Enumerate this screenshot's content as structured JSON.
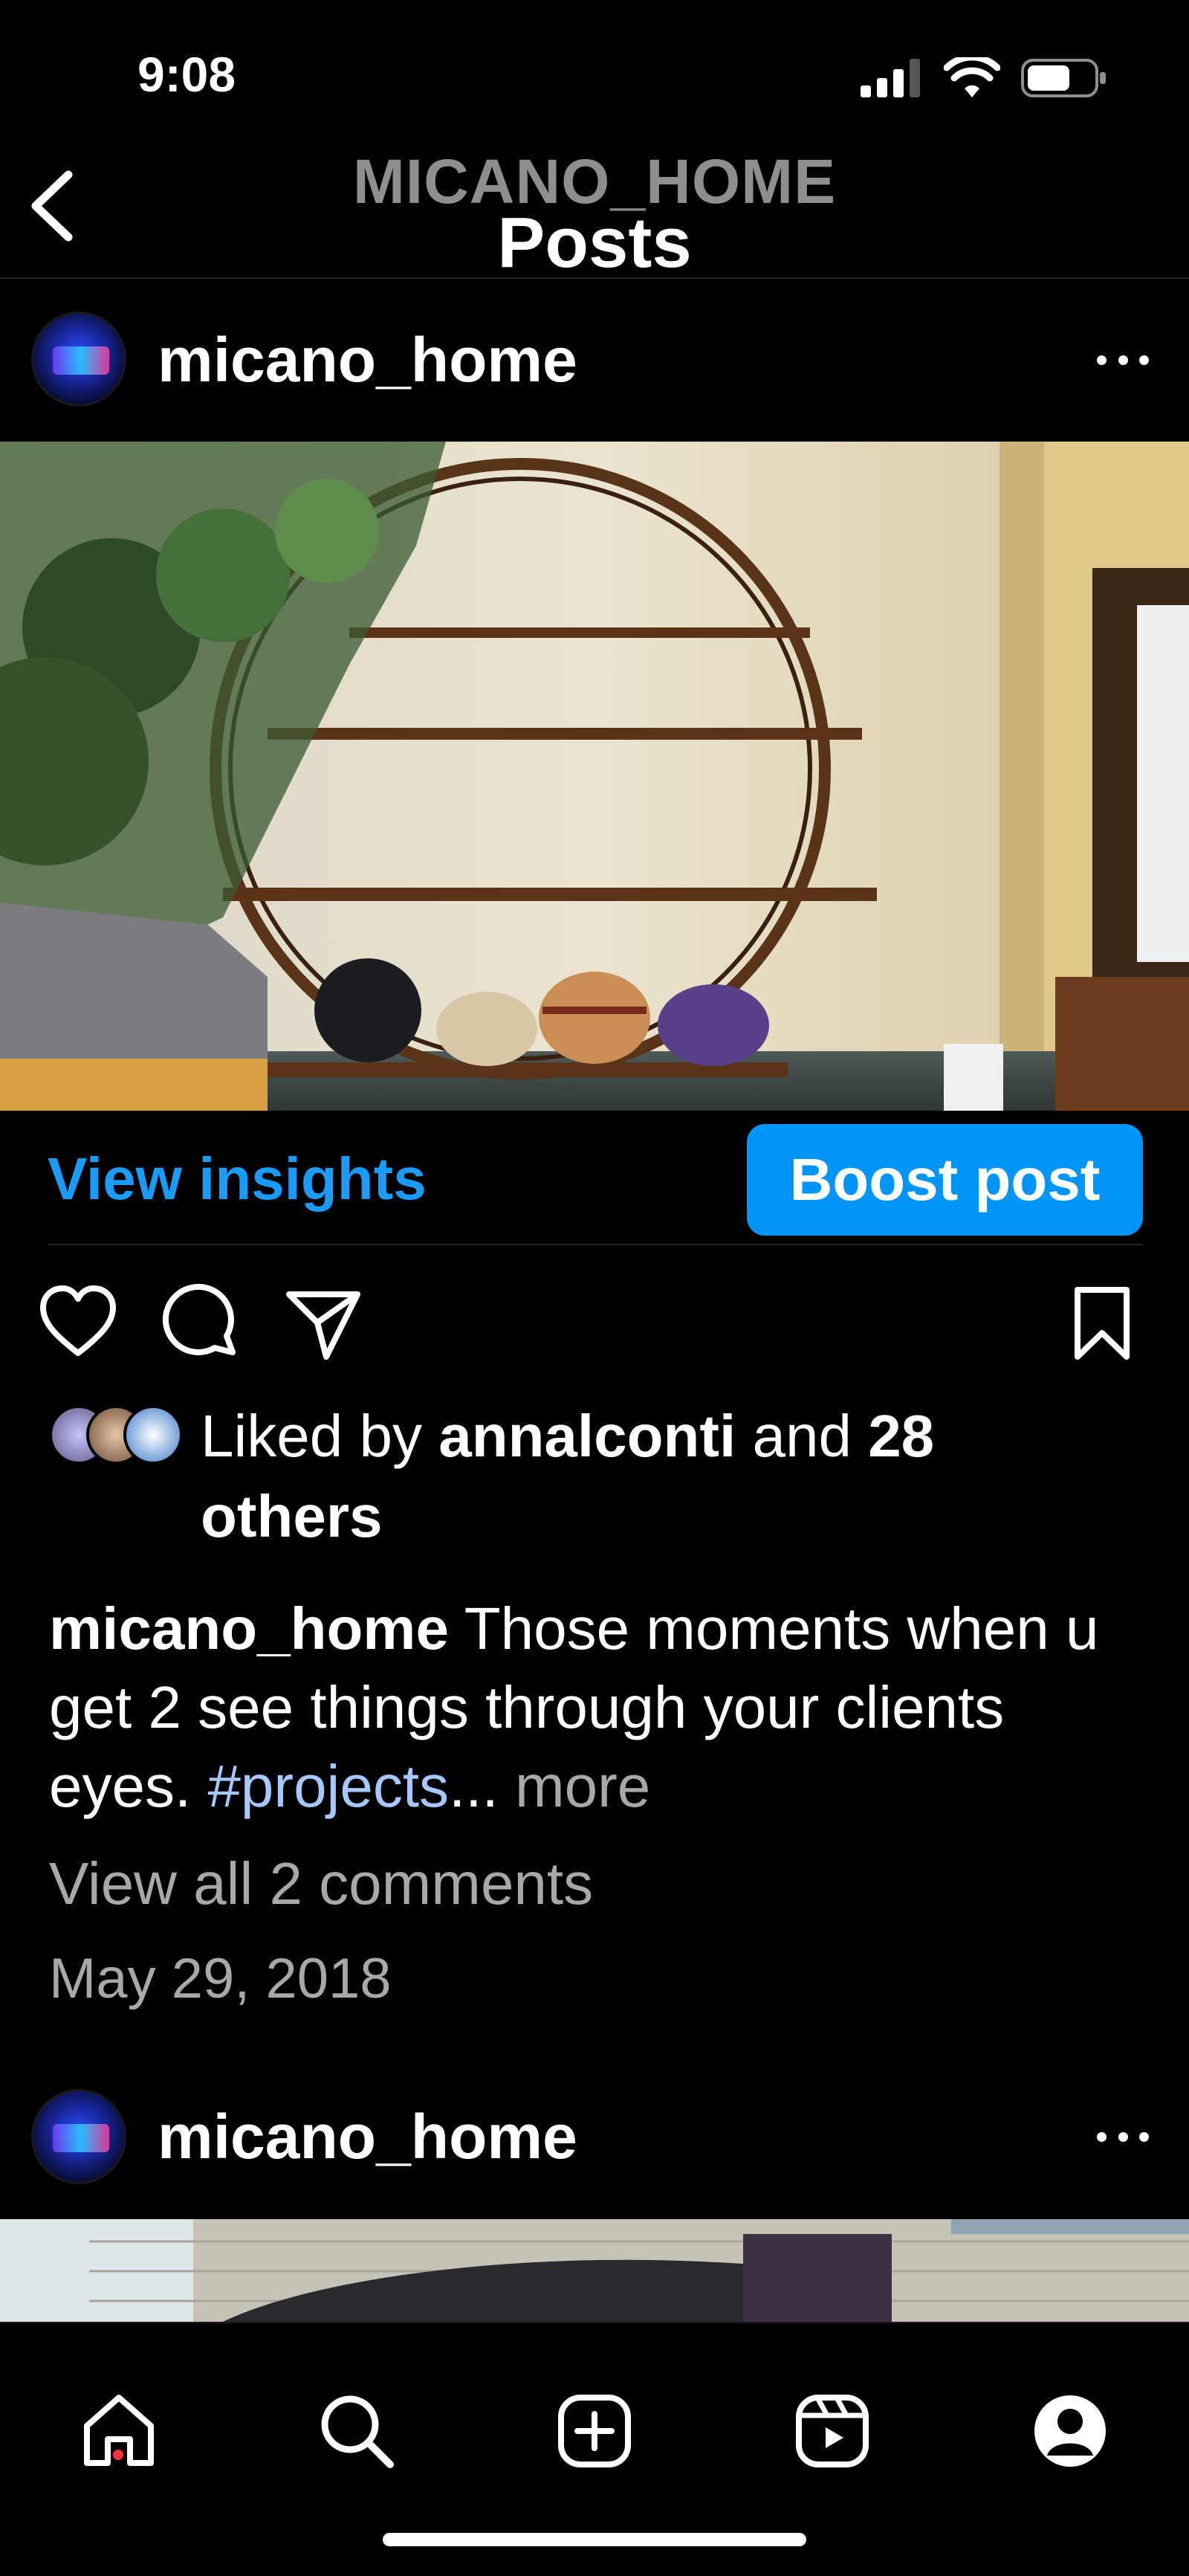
{
  "status_bar": {
    "time": "9:08"
  },
  "header": {
    "account": "MICANO_HOME",
    "title": "Posts"
  },
  "post1": {
    "username": "micano_home",
    "view_insights": "View insights",
    "boost_post": "Boost post",
    "likes": {
      "prefix": "Liked by ",
      "user": "annalconti",
      "mid": " and ",
      "count": "28",
      "suffix": "others"
    },
    "caption": {
      "username": "micano_home",
      "text": " Those moments when u get 2 see things through your clients eyes. ",
      "hashtag": "#projects",
      "ellipsis": "...",
      "more": " more"
    },
    "view_comments": "View all 2 comments",
    "date": "May 29, 2018"
  },
  "post2": {
    "username": "micano_home"
  },
  "colors": {
    "link_blue": "#1a9bf7",
    "button_blue": "#0095f6",
    "muted": "#a8a8a8",
    "notification": "#ff3040"
  },
  "icons": [
    "back-chevron-icon",
    "more-options-icon",
    "heart-icon",
    "comment-icon",
    "share-icon",
    "bookmark-icon",
    "home-icon",
    "search-icon",
    "create-icon",
    "reels-icon",
    "profile-icon"
  ]
}
